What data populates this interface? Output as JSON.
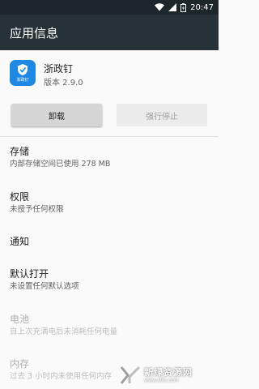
{
  "status_bar": {
    "time": "20:47"
  },
  "header": {
    "title": "应用信息"
  },
  "app": {
    "name": "浙政钉",
    "version": "版本 2.9.0",
    "icon_label": "浙政钉"
  },
  "buttons": {
    "uninstall": "卸载",
    "force_stop": "强行停止",
    "force_stop_enabled": false
  },
  "items": [
    {
      "title": "存储",
      "summary": "内部存储空间已使用 278 MB",
      "enabled": true
    },
    {
      "title": "权限",
      "summary": "未授予任何权限",
      "enabled": true
    },
    {
      "title": "通知",
      "summary": "",
      "enabled": true
    },
    {
      "title": "默认打开",
      "summary": "未设置任何默认选项",
      "enabled": true
    },
    {
      "title": "电池",
      "summary": "自上次充满电后未消耗任何电量",
      "enabled": false
    },
    {
      "title": "内存",
      "summary": "过去 3 小时内未使用任何内存",
      "enabled": false
    }
  ],
  "watermark": {
    "text": "新绿资源网",
    "sub": "www.xlks.com"
  },
  "colors": {
    "status_bar": "#1c262b",
    "app_bar": "#263238",
    "icon_bg": "#1e88e5",
    "background": "#fafafa"
  }
}
